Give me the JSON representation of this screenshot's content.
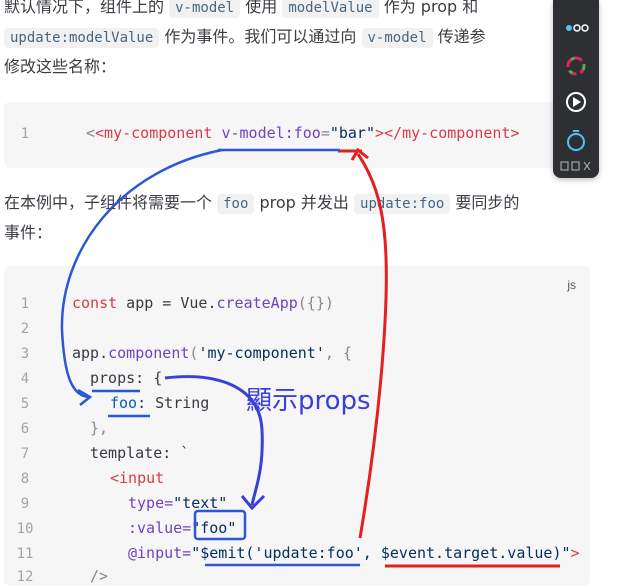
{
  "intro": {
    "line1_a": "默认情况下，组件上的",
    "code_vmodel": "v-model",
    "line1_b": "使用",
    "code_modelValue": "modelValue",
    "line1_c": "作为 prop 和",
    "code_update": "update:modelValue",
    "line2_a": "作为事件。我们可以通过向",
    "line2_code": "v-model",
    "line2_b": "传递参",
    "line3": "修改这些名称："
  },
  "snippet1": {
    "line_number": "1",
    "open_tag": "<my-component",
    "attr": "v-model:foo",
    "eq": "=",
    "value": "\"bar\"",
    "close": "></my-component>"
  },
  "middle": {
    "a": "在本例中，子组件将需要一个",
    "code_foo": "foo",
    "b": "prop 并发出",
    "code_update_foo": "update:foo",
    "c": "要同步的",
    "line2": "事件："
  },
  "snippet2": {
    "lang": "js",
    "line_numbers": [
      "1",
      "2",
      "3",
      "4",
      "5",
      "6",
      "7",
      "8",
      "9",
      "10",
      "11",
      "12"
    ],
    "l1_kw": "const",
    "l1_rest": " app = Vue.",
    "l1_fn": "createApp",
    "l1_end": "({})",
    "l3_a": "app.",
    "l3_fn": "component",
    "l3_b": "(",
    "l3_str": "'my-component'",
    "l3_c": ", {",
    "l4": "props: {",
    "l5_key": "foo",
    "l5_val": ": String",
    "l6": "},",
    "l7": "template: `",
    "l8": "<input",
    "l9_attr": "type=",
    "l9_val": "\"text\"",
    "l10_attr": ":value=",
    "l10_val": "\"foo\"",
    "l11_attr": "@input=",
    "l11_val": "\"$emit('update:foo', $event.target.value)\"",
    "l11_end": ">",
    "l12": "/>"
  },
  "annotation": {
    "text": "顯示props"
  },
  "toolbar": {
    "items": [
      "grid-icon",
      "palette-icon",
      "play-icon",
      "timer-icon"
    ]
  },
  "colors": {
    "blue_ink": "#2b57d6",
    "red_ink": "#e32020",
    "purple_ink": "#3b3fd9"
  }
}
